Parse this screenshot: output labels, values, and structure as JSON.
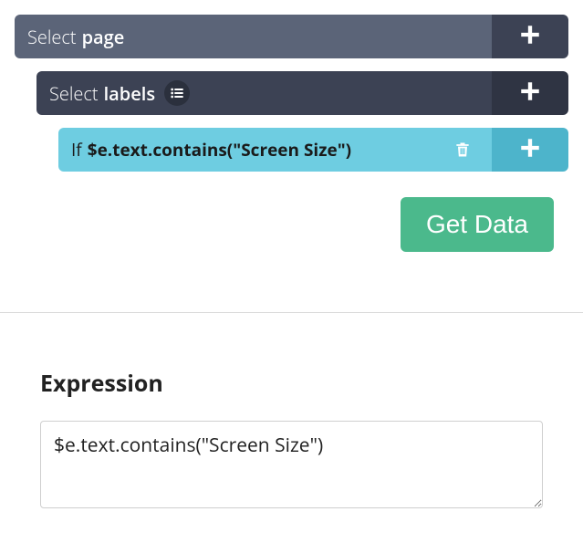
{
  "rows": {
    "page": {
      "select_label": "Select",
      "name_label": "page"
    },
    "labels": {
      "select_label": "Select",
      "name_label": "labels"
    },
    "if": {
      "if_label": "If",
      "expr": "$e.text.contains(\"Screen Size\")"
    }
  },
  "get_data_button": "Get Data",
  "expression": {
    "heading": "Expression",
    "value": "$e.text.contains(\"Screen Size\")"
  }
}
